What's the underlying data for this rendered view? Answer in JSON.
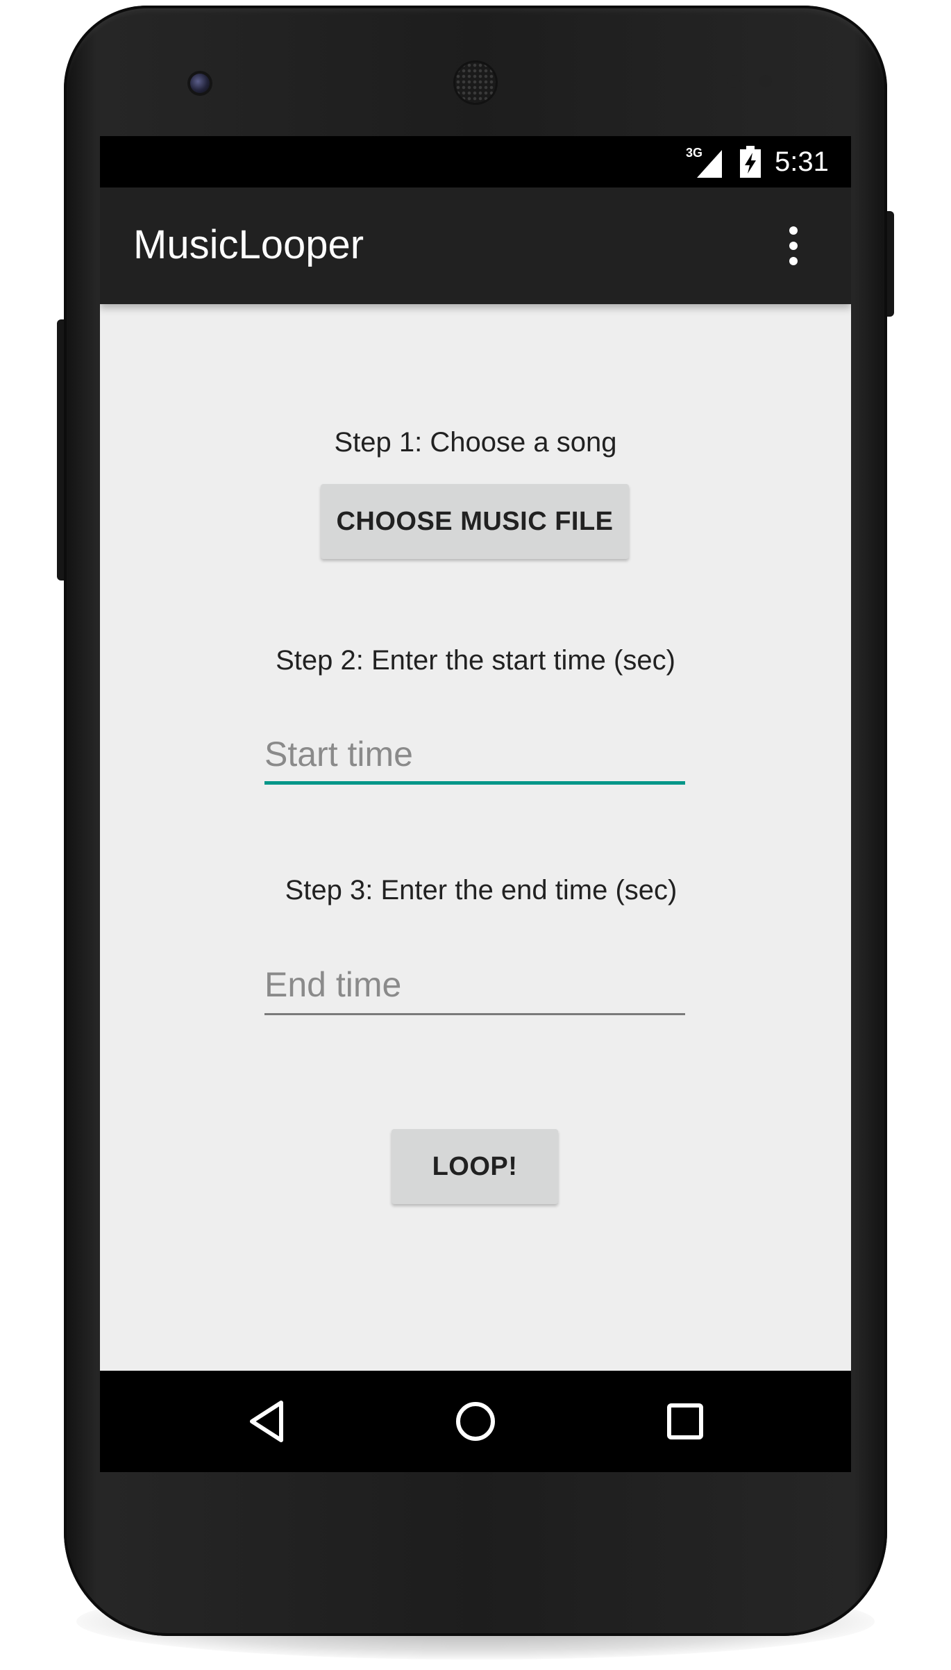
{
  "status_bar": {
    "network_label": "3G",
    "time": "5:31",
    "icons": [
      "signal-icon",
      "battery-charging-icon"
    ]
  },
  "app_bar": {
    "title": "MusicLooper",
    "overflow_icon": "more-vert-icon"
  },
  "step1": {
    "label": "Step 1: Choose a song",
    "button_label": "CHOOSE MUSIC FILE"
  },
  "step2": {
    "label": "Step 2: Enter the start time (sec)",
    "value": "",
    "placeholder": "Start time"
  },
  "step3": {
    "label": "Step 3: Enter the end time (sec)",
    "value": "",
    "placeholder": "End time"
  },
  "loop_button_label": "LOOP!",
  "nav_bar": {
    "icons": [
      "back-icon",
      "home-icon",
      "recents-icon"
    ]
  },
  "colors": {
    "accent": "#009688",
    "app_bar": "#212121",
    "background": "#eeeeee",
    "button": "#d6d7d7"
  }
}
